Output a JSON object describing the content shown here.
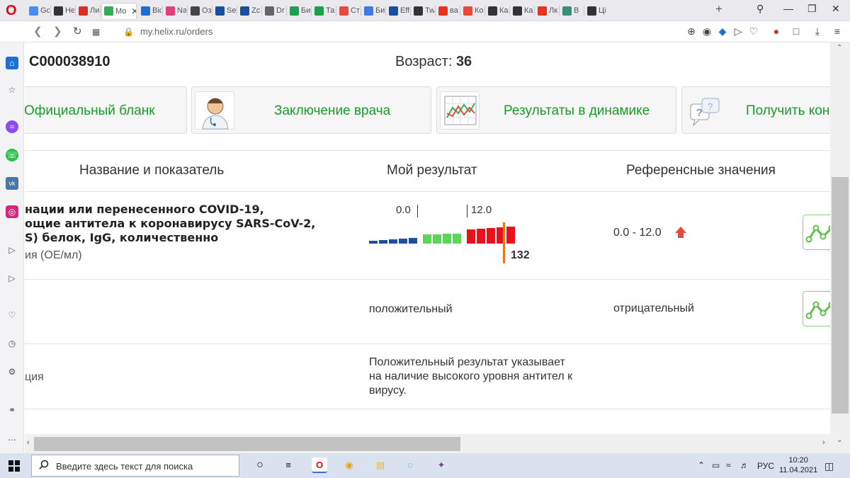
{
  "tabs": [
    {
      "label": "Gc",
      "color": "#4a8cf7",
      "active": false
    },
    {
      "label": "Не",
      "color": "#333333",
      "active": false
    },
    {
      "label": "Ли",
      "color": "#d93025",
      "active": false
    },
    {
      "label": "Мо",
      "color": "#2fae5a",
      "active": true
    },
    {
      "label": "Віс",
      "color": "#1f6fd1",
      "active": false
    },
    {
      "label": "Na",
      "color": "#e0407b",
      "active": false
    },
    {
      "label": "Оз",
      "color": "#444444",
      "active": false
    },
    {
      "label": "Se",
      "color": "#1a4f9c",
      "active": false
    },
    {
      "label": "Zc",
      "color": "#1a4f9c",
      "active": false
    },
    {
      "label": "Dr",
      "color": "#666666",
      "active": false
    },
    {
      "label": "Би",
      "color": "#1e9e4f",
      "active": false
    },
    {
      "label": "Та",
      "color": "#1e9e4f",
      "active": false
    },
    {
      "label": "Ст",
      "color": "#e84a3c",
      "active": false
    },
    {
      "label": "Би",
      "color": "#3d7be0",
      "active": false
    },
    {
      "label": "Eff",
      "color": "#1a4f9c",
      "active": false
    },
    {
      "label": "Tw",
      "color": "#333333",
      "active": false
    },
    {
      "label": "ва",
      "color": "#e8321e",
      "active": false
    },
    {
      "label": "Ко",
      "color": "#e84a3c",
      "active": false
    },
    {
      "label": "Ка",
      "color": "#333333",
      "active": false
    },
    {
      "label": "Ка",
      "color": "#333333",
      "active": false
    },
    {
      "label": "Лк",
      "color": "#e8321e",
      "active": false
    },
    {
      "label": "В",
      "color": "#3a8f7a",
      "active": false
    },
    {
      "label": "Ці",
      "color": "#333333",
      "active": false
    }
  ],
  "address": {
    "url": "my.helix.ru/orders"
  },
  "patient": {
    "id": "C000038910",
    "age_label": "Возраст:",
    "age": "36"
  },
  "cards": [
    {
      "label": "Официальный бланк"
    },
    {
      "label": "Заключение врача"
    },
    {
      "label": "Результаты в динамике"
    },
    {
      "label": "Получить кон"
    }
  ],
  "table": {
    "headers": [
      "Название и показатель",
      "Мой результат",
      "Референсные значения"
    ],
    "row1": {
      "name_lines": [
        "нации или перенесенного COVID-19,",
        "ощие антитела к коронавирусу SARS-CoV-2,",
        "S) белок, IgG, количественно"
      ],
      "unit": "ия (ОЕ/мл)",
      "scale_low": "0.0",
      "scale_high": "12.0",
      "value": "132",
      "reference": "0.0 - 12.0"
    },
    "row2": {
      "result": "положительный",
      "reference": "отрицательный"
    },
    "row3": {
      "left": "ция",
      "note_lines": [
        "Положительный результат указывает",
        "на наличие высокого уровня антител к",
        "вирусу."
      ]
    }
  },
  "taskbar": {
    "search_placeholder": "Введите здесь текст для поиска",
    "lang": "РУС",
    "time": "10:20",
    "date": "11.04.2021"
  },
  "colors": {
    "accent_green": "#1a9a2a",
    "bar_blue": "#1f4f9c",
    "bar_green": "#5fd45a",
    "bar_red": "#e8121e",
    "marker": "#e8761e"
  }
}
